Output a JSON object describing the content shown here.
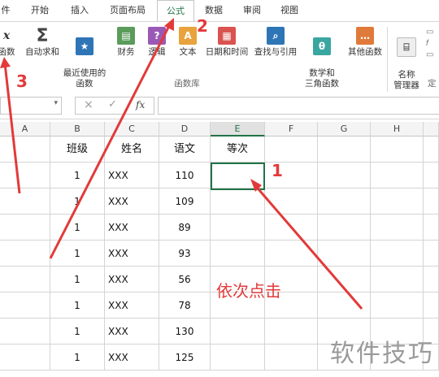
{
  "tabs": [
    "件",
    "开始",
    "插入",
    "页面布局",
    "公式",
    "数据",
    "审阅",
    "视图"
  ],
  "active_tab": "公式",
  "ribbon": {
    "buttons": [
      {
        "label": "函数",
        "icon": "insert-function-icon",
        "color": "#555555"
      },
      {
        "label": "自动求和",
        "icon": "sigma-icon",
        "color": "#555555"
      },
      {
        "label": "最近使用的\n函数",
        "icon": "star-icon",
        "color": "#2e75b6"
      },
      {
        "label": "财务",
        "icon": "book-icon",
        "color": "#5b9b5b"
      },
      {
        "label": "逻辑",
        "icon": "question-icon",
        "color": "#9b59b6"
      },
      {
        "label": "文本",
        "icon": "text-a-icon",
        "color": "#e8a33d"
      },
      {
        "label": "日期和时间",
        "icon": "calendar-icon",
        "color": "#d9534f"
      },
      {
        "label": "查找与引用",
        "icon": "magnifier-icon",
        "color": "#2e75b6"
      },
      {
        "label": "数学和\n三角函数",
        "icon": "theta-icon",
        "color": "#3aa6a0"
      },
      {
        "label": "其他函数",
        "icon": "more-functions-icon",
        "color": "#e07a3a"
      },
      {
        "label": "名称\n管理器",
        "icon": "name-manager-icon",
        "color": "#777777"
      }
    ],
    "group_label": "函数库",
    "right_cut_label": "定"
  },
  "formula_bar": {
    "fx": "fx",
    "cancel": "×",
    "enter": "✓"
  },
  "columns": [
    "A",
    "B",
    "C",
    "D",
    "E",
    "F",
    "G",
    "H"
  ],
  "header_row": [
    "",
    "班级",
    "姓名",
    "语文",
    "等次",
    "",
    "",
    ""
  ],
  "rows": [
    [
      "",
      "1",
      "XXX",
      "110",
      "",
      "",
      "",
      ""
    ],
    [
      "",
      "1",
      "XXX",
      "109",
      "",
      "",
      "",
      ""
    ],
    [
      "",
      "1",
      "XXX",
      "89",
      "",
      "",
      "",
      ""
    ],
    [
      "",
      "1",
      "XXX",
      "93",
      "",
      "",
      "",
      ""
    ],
    [
      "",
      "1",
      "XXX",
      "56",
      "",
      "",
      "",
      ""
    ],
    [
      "",
      "1",
      "XXX",
      "78",
      "",
      "",
      "",
      ""
    ],
    [
      "",
      "1",
      "XXX",
      "130",
      "",
      "",
      "",
      ""
    ],
    [
      "",
      "1",
      "XXX",
      "125",
      "",
      "",
      "",
      ""
    ]
  ],
  "annotations": {
    "step1": "1",
    "step2": "2",
    "step3": "3",
    "hint": "依次点击"
  },
  "watermark": "软件技巧",
  "colors": {
    "accent": "#217346",
    "arrow": "#e23a3a"
  }
}
